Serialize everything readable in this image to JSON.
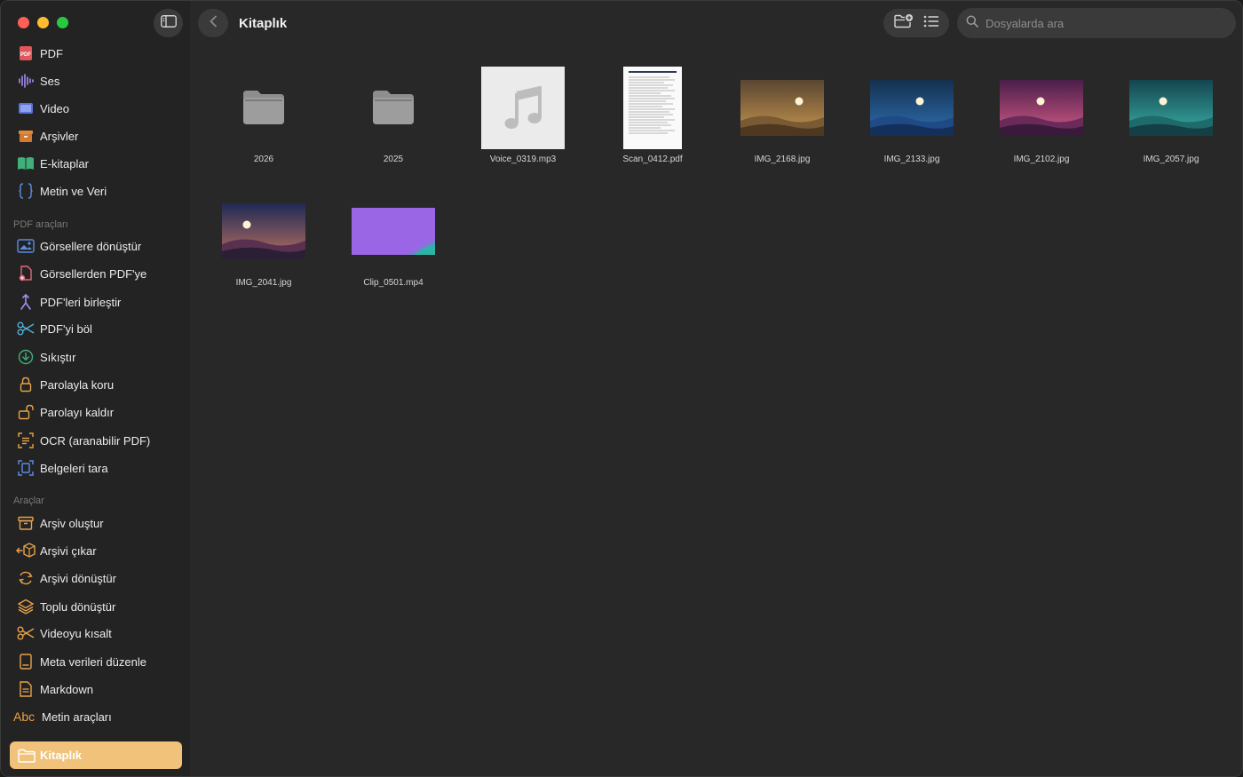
{
  "window": {
    "title": "Kitaplık"
  },
  "toolbar": {
    "search_placeholder": "Dosyalarda ara"
  },
  "sidebar": {
    "top_items": [
      {
        "label": "PDF",
        "icon": "pdf-icon"
      },
      {
        "label": "Ses",
        "icon": "audio-wave-icon"
      },
      {
        "label": "Video",
        "icon": "video-icon"
      },
      {
        "label": "Arşivler",
        "icon": "archive-icon"
      },
      {
        "label": "E-kitaplar",
        "icon": "book-icon"
      },
      {
        "label": "Metin ve Veri",
        "icon": "braces-icon"
      }
    ],
    "pdf_tools_label": "PDF araçları",
    "pdf_tools": [
      {
        "label": "Görsellere dönüştür",
        "icon": "image-convert-icon"
      },
      {
        "label": "Görsellerden PDF'ye",
        "icon": "file-plus-icon"
      },
      {
        "label": "PDF'leri birleştir",
        "icon": "merge-icon"
      },
      {
        "label": "PDF'yi böl",
        "icon": "scissors-icon"
      },
      {
        "label": "Sıkıştır",
        "icon": "compress-icon"
      },
      {
        "label": "Parolayla koru",
        "icon": "lock-icon"
      },
      {
        "label": "Parolayı kaldır",
        "icon": "unlock-icon"
      },
      {
        "label": "OCR (aranabilir PDF)",
        "icon": "ocr-icon"
      },
      {
        "label": "Belgeleri tara",
        "icon": "scan-icon"
      }
    ],
    "tools_label": "Araçlar",
    "tools": [
      {
        "label": "Arşiv oluştur",
        "icon": "archive-create-icon"
      },
      {
        "label": "Arşivi çıkar",
        "icon": "extract-icon"
      },
      {
        "label": "Arşivi dönüştür",
        "icon": "refresh-icon"
      },
      {
        "label": "Toplu dönüştür",
        "icon": "layers-icon"
      },
      {
        "label": "Videoyu kısalt",
        "icon": "scissors-icon"
      },
      {
        "label": "Meta verileri düzenle",
        "icon": "metadata-icon"
      },
      {
        "label": "Markdown",
        "icon": "document-icon"
      },
      {
        "label": "Metin araçları",
        "icon": "abc-icon",
        "icon_text": "Abc"
      }
    ],
    "active_item": {
      "label": "Kitaplık",
      "icon": "folder-icon"
    }
  },
  "files": [
    {
      "name": "2026",
      "kind": "folder"
    },
    {
      "name": "2025",
      "kind": "folder"
    },
    {
      "name": "Voice_0319.mp3",
      "kind": "audio"
    },
    {
      "name": "Scan_0412.pdf",
      "kind": "pdf"
    },
    {
      "name": "IMG_2168.jpg",
      "kind": "image",
      "sky": "#8a6a3a",
      "hill": "#5a3f22"
    },
    {
      "name": "IMG_2133.jpg",
      "kind": "image",
      "sky": "#1f4a86",
      "hill": "#183a6a"
    },
    {
      "name": "IMG_2102.jpg",
      "kind": "image",
      "sky": "#8a3a6a",
      "hill": "#4a2550"
    },
    {
      "name": "IMG_2057.jpg",
      "kind": "image",
      "sky": "#1f7a7a",
      "hill": "#175a5c"
    },
    {
      "name": "IMG_2041.jpg",
      "kind": "image",
      "sky": "#3a3a6a",
      "hill": "#4a2a45"
    },
    {
      "name": "Clip_0501.mp4",
      "kind": "video"
    }
  ],
  "colors": {
    "accent": "#f0c27a",
    "sidebar_bg": "#232323",
    "content_bg": "#282828"
  }
}
